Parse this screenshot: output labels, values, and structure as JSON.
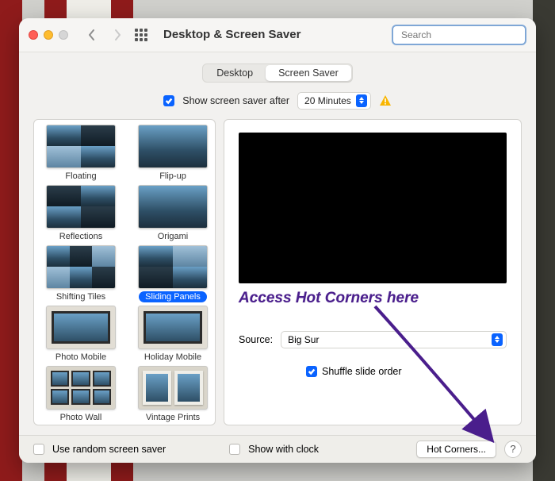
{
  "window": {
    "title": "Desktop & Screen Saver"
  },
  "search": {
    "placeholder": "Search"
  },
  "tabs": {
    "desktop": "Desktop",
    "screensaver": "Screen Saver"
  },
  "showAfter": {
    "label": "Show screen saver after",
    "value": "20 Minutes",
    "checked": true
  },
  "savers": [
    {
      "name": "Floating"
    },
    {
      "name": "Flip-up"
    },
    {
      "name": "Reflections"
    },
    {
      "name": "Origami"
    },
    {
      "name": "Shifting Tiles"
    },
    {
      "name": "Sliding Panels",
      "selected": true
    },
    {
      "name": "Photo Mobile"
    },
    {
      "name": "Holiday Mobile"
    },
    {
      "name": "Photo Wall"
    },
    {
      "name": "Vintage Prints"
    }
  ],
  "annotation": "Access Hot Corners here",
  "source": {
    "label": "Source:",
    "value": "Big Sur"
  },
  "shuffle": {
    "label": "Shuffle slide order",
    "checked": true
  },
  "bottom": {
    "random": "Use random screen saver",
    "clock": "Show with clock",
    "hotcorners": "Hot Corners...",
    "help": "?"
  }
}
